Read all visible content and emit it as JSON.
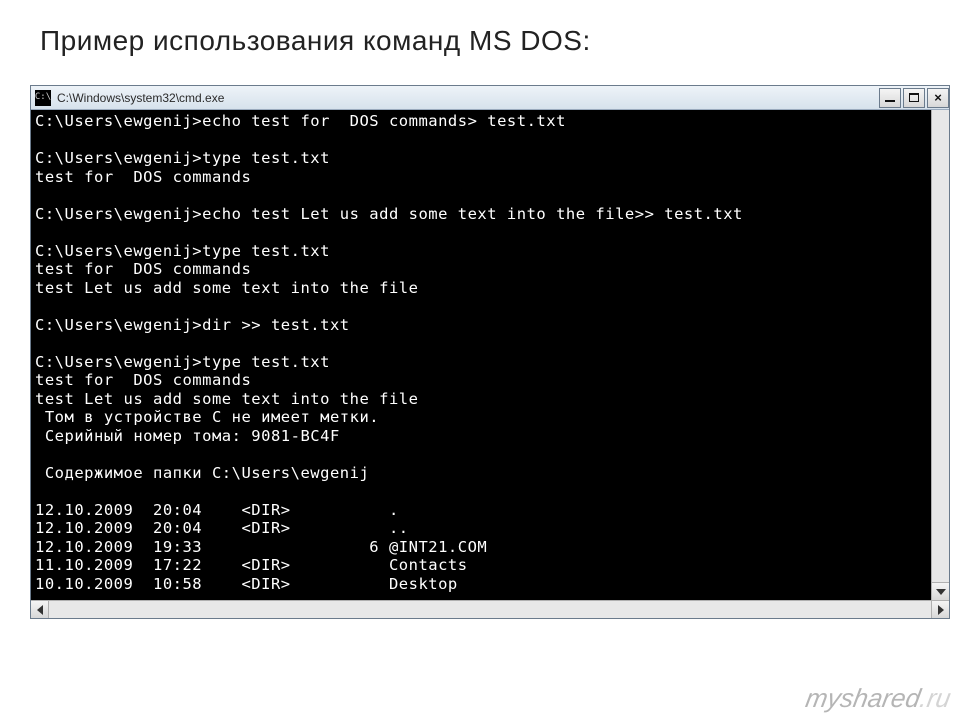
{
  "heading": "Пример использования команд MS DOS:",
  "window": {
    "icon_label": "C:\\",
    "title": "C:\\Windows\\system32\\cmd.exe"
  },
  "terminal_lines": [
    "C:\\Users\\ewgenij>echo test for  DOS commands> test.txt",
    "",
    "C:\\Users\\ewgenij>type test.txt",
    "test for  DOS commands",
    "",
    "C:\\Users\\ewgenij>echo test Let us add some text into the file>> test.txt",
    "",
    "C:\\Users\\ewgenij>type test.txt",
    "test for  DOS commands",
    "test Let us add some text into the file",
    "",
    "C:\\Users\\ewgenij>dir >> test.txt",
    "",
    "C:\\Users\\ewgenij>type test.txt",
    "test for  DOS commands",
    "test Let us add some text into the file",
    " Том в устройстве C не имеет метки.",
    " Серийный номер тома: 9081-BC4F",
    "",
    " Содержимое папки C:\\Users\\ewgenij",
    "",
    "12.10.2009  20:04    <DIR>          .",
    "12.10.2009  20:04    <DIR>          ..",
    "12.10.2009  19:33                 6 @INT21.COM",
    "11.10.2009  17:22    <DIR>          Contacts",
    "10.10.2009  10:58    <DIR>          Desktop"
  ],
  "watermark": {
    "main": "myshared",
    "suffix": ".ru"
  }
}
